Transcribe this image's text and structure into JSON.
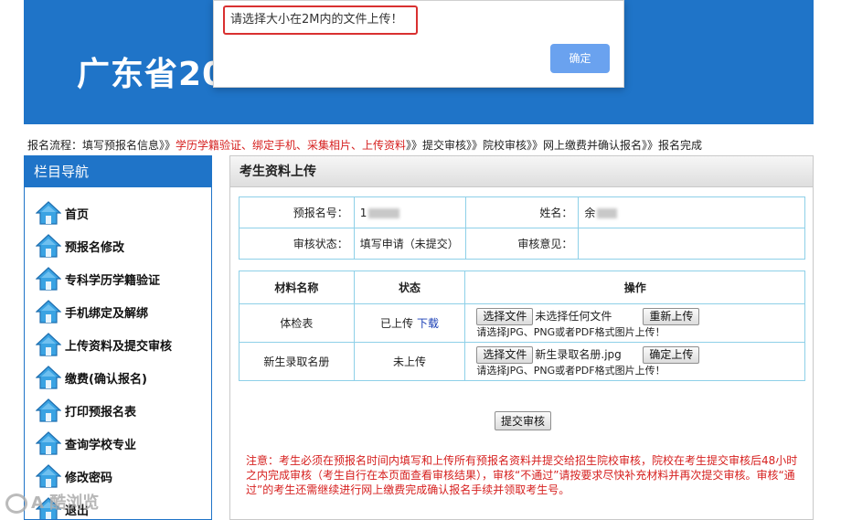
{
  "banner": {
    "title": "广东省20"
  },
  "flow": {
    "prefix": "报名流程：填写预报名信息》》",
    "highlight": "学历学籍验证、绑定手机、采集相片、上传资料",
    "suffix": "》》提交审核》》院校审核》》网上缴费并确认报名》》报名完成"
  },
  "sidebar": {
    "title": "栏目导航",
    "items": [
      {
        "label": "首页",
        "icon": "house-icon"
      },
      {
        "label": "预报名修改",
        "icon": "house-icon"
      },
      {
        "label": "专科学历学籍验证",
        "icon": "house-icon"
      },
      {
        "label": "手机绑定及解绑",
        "icon": "house-icon"
      },
      {
        "label": "上传资料及提交审核",
        "icon": "house-icon"
      },
      {
        "label": "缴费(确认报名)",
        "icon": "house-icon"
      },
      {
        "label": "打印预报名表",
        "icon": "house-icon"
      },
      {
        "label": "查询学校专业",
        "icon": "house-icon"
      },
      {
        "label": "修改密码",
        "icon": "house-icon"
      },
      {
        "label": "退出",
        "icon": "house-icon"
      }
    ]
  },
  "panel": {
    "title": "考生资料上传",
    "info": {
      "regno_label": "预报名号：",
      "regno_value": "1",
      "name_label": "姓名：",
      "name_value": "余",
      "status_label": "审核状态：",
      "status_value": "填写申请（未提交）",
      "opinion_label": "审核意见：",
      "opinion_value": ""
    },
    "materials": {
      "headers": [
        "材料名称",
        "状态",
        "操作"
      ],
      "choose_label": "选择文件",
      "hint": "请选择JPG、PNG或者PDF格式图片上传！",
      "rows": [
        {
          "name": "体检表",
          "status": "已上传",
          "download": "下载",
          "file": "未选择任何文件",
          "action": "重新上传"
        },
        {
          "name": "新生录取名册",
          "status": "未上传",
          "download": "",
          "file": "新生录取名册.jpg",
          "action": "确定上传"
        }
      ]
    },
    "submit_label": "提交审核",
    "notice": "注意：考生必须在预报名时间内填写和上传所有预报名资料并提交给招生院校审核，院校在考生提交审核后48小时之内完成审核（考生自行在本页面查看审核结果），审核“不通过”请按要求尽快补充材料并再次提交审核。审核“通过”的考生还需继续进行网上缴费完成确认报名手续并领取考生号。"
  },
  "dialog": {
    "message": "请选择大小在2M内的文件上传！",
    "ok_label": "确定"
  },
  "watermark": {
    "text": "A 酷浏览"
  },
  "colors": {
    "brand_blue": "#1f74c8",
    "alert_red": "#d6201f",
    "table_border": "#8ed0e8",
    "button_blue": "#6aa2ef"
  }
}
